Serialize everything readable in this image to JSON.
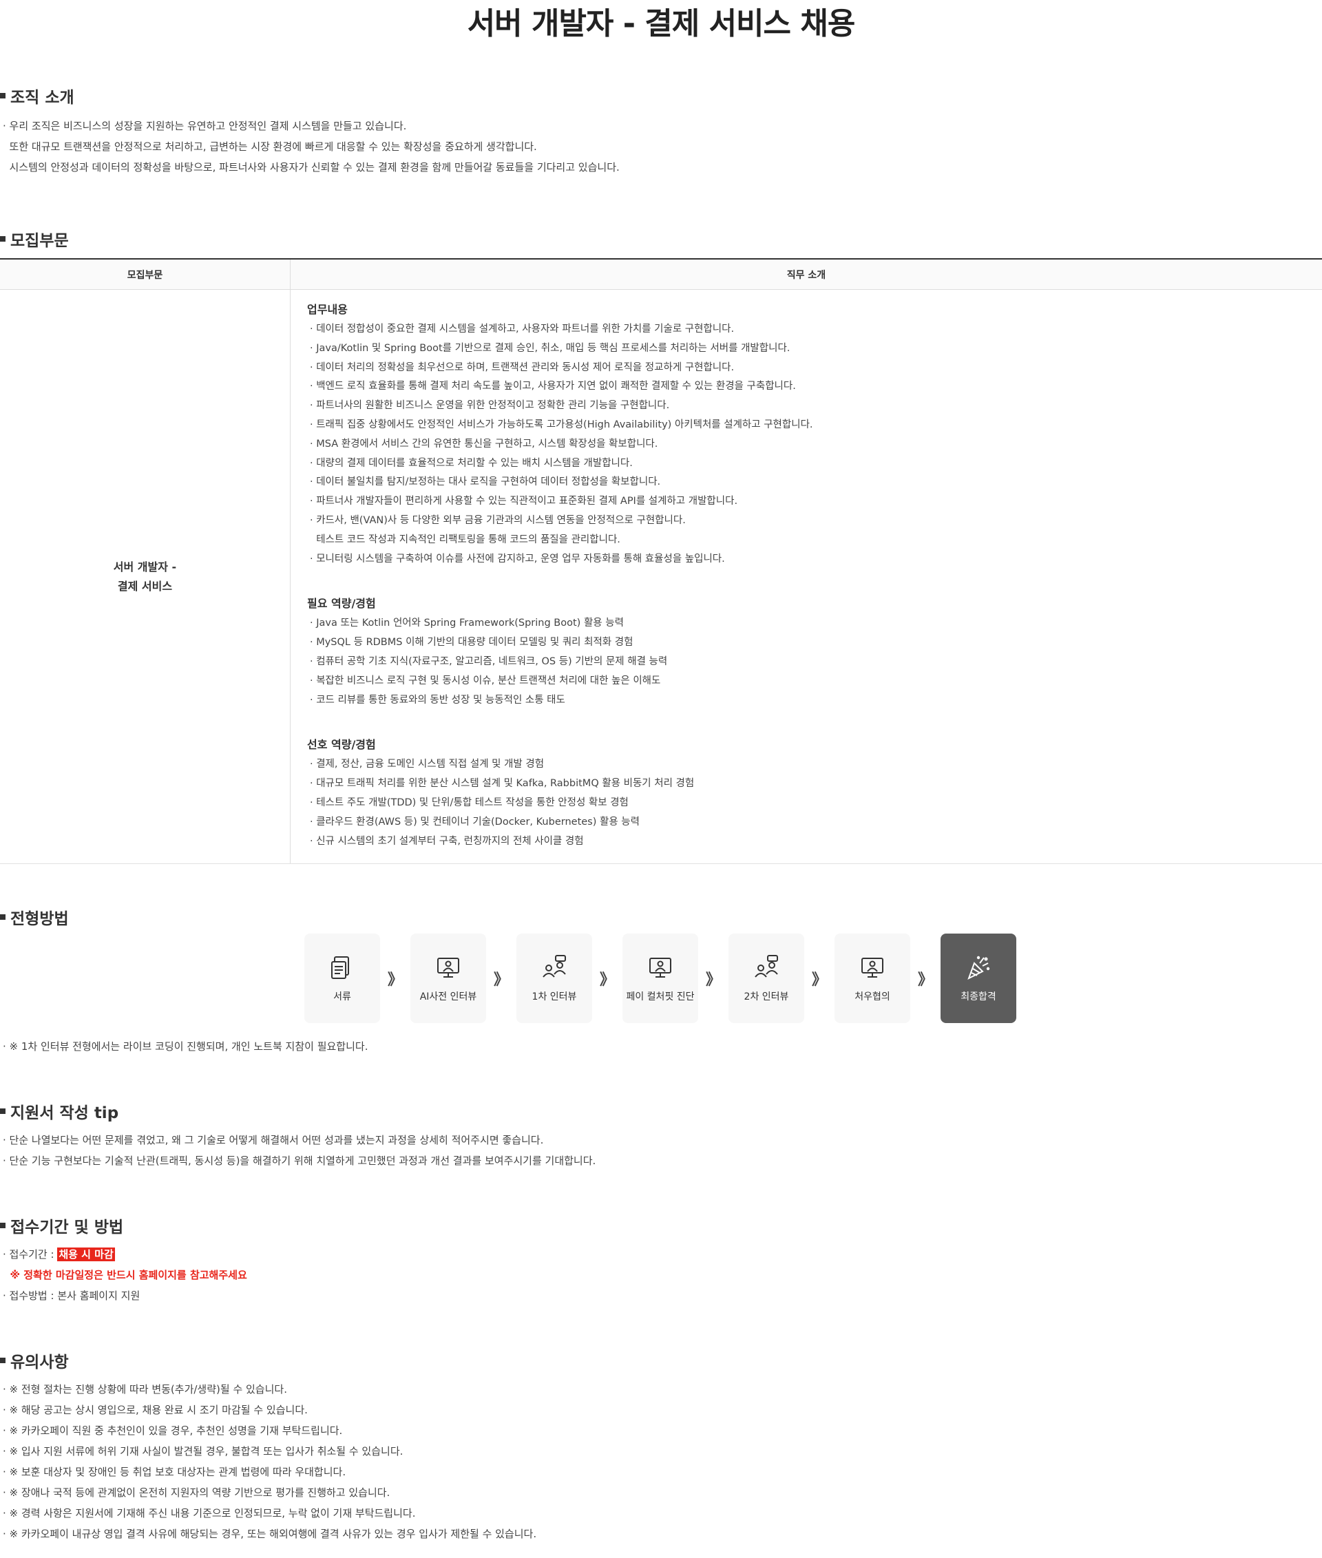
{
  "page": {
    "title": "서버 개발자 - 결제 서비스 채용"
  },
  "org": {
    "heading": "조직 소개",
    "lines": [
      "· 우리 조직은 비즈니스의 성장을 지원하는 유연하고 안정적인 결제 시스템을 만들고 있습니다.",
      "  또한 대규모 트랜잭션을 안정적으로 처리하고, 급변하는 시장 환경에 빠르게 대응할 수 있는 확장성을 중요하게 생각합니다.",
      "  시스템의 안정성과 데이터의 정확성을 바탕으로, 파트너사와 사용자가 신뢰할 수 있는 결제 환경을 함께 만들어갈 동료들을 기다리고 있습니다."
    ]
  },
  "recruit": {
    "heading": "모집부문",
    "col_dept": "모집부문",
    "col_desc": "직무 소개",
    "dept_line1": "서버 개발자 -",
    "dept_line2": "결제 서비스",
    "duties_heading": "업무내용",
    "duties": [
      "· 데이터 정합성이 중요한 결제 시스템을 설계하고, 사용자와 파트너를 위한 가치를 기술로 구현합니다.",
      "· Java/Kotlin 및 Spring Boot를 기반으로 결제 승인, 취소, 매입 등 핵심 프로세스를 처리하는 서버를 개발합니다.",
      "· 데이터 처리의 정확성을 최우선으로 하며, 트랜잭션 관리와 동시성 제어 로직을 정교하게 구현합니다.",
      "· 백엔드 로직 효율화를 통해 결제 처리 속도를 높이고, 사용자가 지연 없이 쾌적한 결제할 수 있는 환경을 구축합니다.",
      "· 파트너사의 원활한 비즈니스 운영을 위한 안정적이고 정확한 관리 기능을 구현합니다.",
      "· 트래픽 집중 상황에서도 안정적인 서비스가 가능하도록 고가용성(High Availability) 아키텍처를 설계하고 구현합니다.",
      "· MSA 환경에서 서비스 간의 유연한 통신을 구현하고, 시스템 확장성을 확보합니다.",
      "· 대량의 결제 데이터를 효율적으로 처리할 수 있는 배치 시스템을 개발합니다.",
      "· 데이터 불일치를 탐지/보정하는 대사 로직을 구현하여 데이터 정합성을 확보합니다.",
      "· 파트너사 개발자들이 편리하게 사용할 수 있는 직관적이고 표준화된 결제 API를 설계하고 개발합니다.",
      "· 카드사, 밴(VAN)사 등 다양한 외부 금융 기관과의 시스템 연동을 안정적으로 구현합니다.",
      "  테스트 코드 작성과 지속적인 리팩토링을 통해 코드의 품질을 관리합니다.",
      "· 모니터링 시스템을 구축하여 이슈를 사전에 감지하고, 운영 업무 자동화를 통해 효율성을 높입니다."
    ],
    "required_heading": "필요 역량/경험",
    "required": [
      "· Java 또는 Kotlin 언어와 Spring Framework(Spring Boot) 활용 능력",
      "· MySQL 등 RDBMS 이해 기반의 대용량 데이터 모델링 및 쿼리 최적화 경험",
      "· 컴퓨터 공학 기초 지식(자료구조, 알고리즘, 네트워크, OS 등) 기반의 문제 해결 능력",
      "· 복잡한 비즈니스 로직 구현 및 동시성 이슈, 분산 트랜잭션 처리에 대한 높은 이해도",
      "· 코드 리뷰를 통한 동료와의 동반 성장 및 능동적인 소통 태도"
    ],
    "preferred_heading": "선호 역량/경험",
    "preferred": [
      "· 결제, 정산, 금융 도메인 시스템 직접 설계 및 개발 경험",
      "· 대규모 트래픽 처리를 위한 분산 시스템 설계 및 Kafka, RabbitMQ 활용 비동기 처리 경험",
      "· 테스트 주도 개발(TDD) 및 단위/통합 테스트 작성을 통한 안정성 확보 경험",
      "· 클라우드 환경(AWS 등) 및 컨테이너 기술(Docker, Kubernetes) 활용 능력",
      "· 신규 시스템의 초기 설계부터 구축, 런칭까지의 전체 사이클 경험"
    ]
  },
  "process": {
    "heading": "전형방법",
    "arrow": "》",
    "steps": [
      {
        "label": "서류",
        "icon": "document-icon"
      },
      {
        "label": "AI사전 인터뷰",
        "icon": "monitor-person-icon"
      },
      {
        "label": "1차 인터뷰",
        "icon": "people-talk-icon"
      },
      {
        "label": "페이 컬처핏 진단",
        "icon": "monitor-person-icon"
      },
      {
        "label": "2차 인터뷰",
        "icon": "people-talk-icon"
      },
      {
        "label": "처우협의",
        "icon": "monitor-person-icon"
      },
      {
        "label": "최종합격",
        "icon": "party-popper-icon"
      }
    ],
    "note": "· ※ 1차 인터뷰 전형에서는 라이브 코딩이 진행되며, 개인 노트북 지참이 필요합니다."
  },
  "tips": {
    "heading": "지원서 작성 tip",
    "lines": [
      "· 단순 나열보다는 어떤 문제를 겪었고, 왜 그 기술로 어떻게 해결해서 어떤 성과를 냈는지 과정을 상세히 적어주시면 좋습니다.",
      "· 단순 기능 구현보다는 기술적 난관(트래픽, 동시성 등)을 해결하기 위해 치열하게 고민했던 과정과 개선 결과를 보여주시기를 기대합니다."
    ]
  },
  "apply": {
    "heading": "접수기간 및 방법",
    "period_label": "· 접수기간 : ",
    "period_value": "채용 시 마감",
    "warning": "  ※ 정확한 마감일정은 반드시 홈페이지를 참고해주세요",
    "method": "· 접수방법 : 본사 홈페이지 지원"
  },
  "notes": {
    "heading": "유의사항",
    "lines": [
      "· ※ 전형 절차는 진행 상황에 따라 변동(추가/생략)될 수 있습니다.",
      "· ※ 해당 공고는 상시 영입으로, 채용 완료 시 조기 마감될 수 있습니다.",
      "· ※ 카카오페이 직원 중 추천인이 있을 경우, 추천인 성명을 기재 부탁드립니다.",
      "· ※ 입사 지원 서류에 허위 기재 사실이 발견될 경우, 불합격 또는 입사가 취소될 수 있습니다.",
      "· ※ 보훈 대상자 및 장애인 등 취업 보호 대상자는 관계 법령에 따라 우대합니다.",
      "· ※ 장애나 국적 등에 관계없이 온전히 지원자의 역량 기반으로 평가를 진행하고 있습니다.",
      "· ※ 경력 사항은 지원서에 기재해 주신 내용 기준으로 인정되므로, 누락 없이 기재 부탁드립니다.",
      "· ※ 카카오페이 내규상 영입 결격 사유에 해당되는 경우, 또는 해외여행에 결격 사유가 있는 경우 입사가 제한될 수 있습니다."
    ]
  }
}
